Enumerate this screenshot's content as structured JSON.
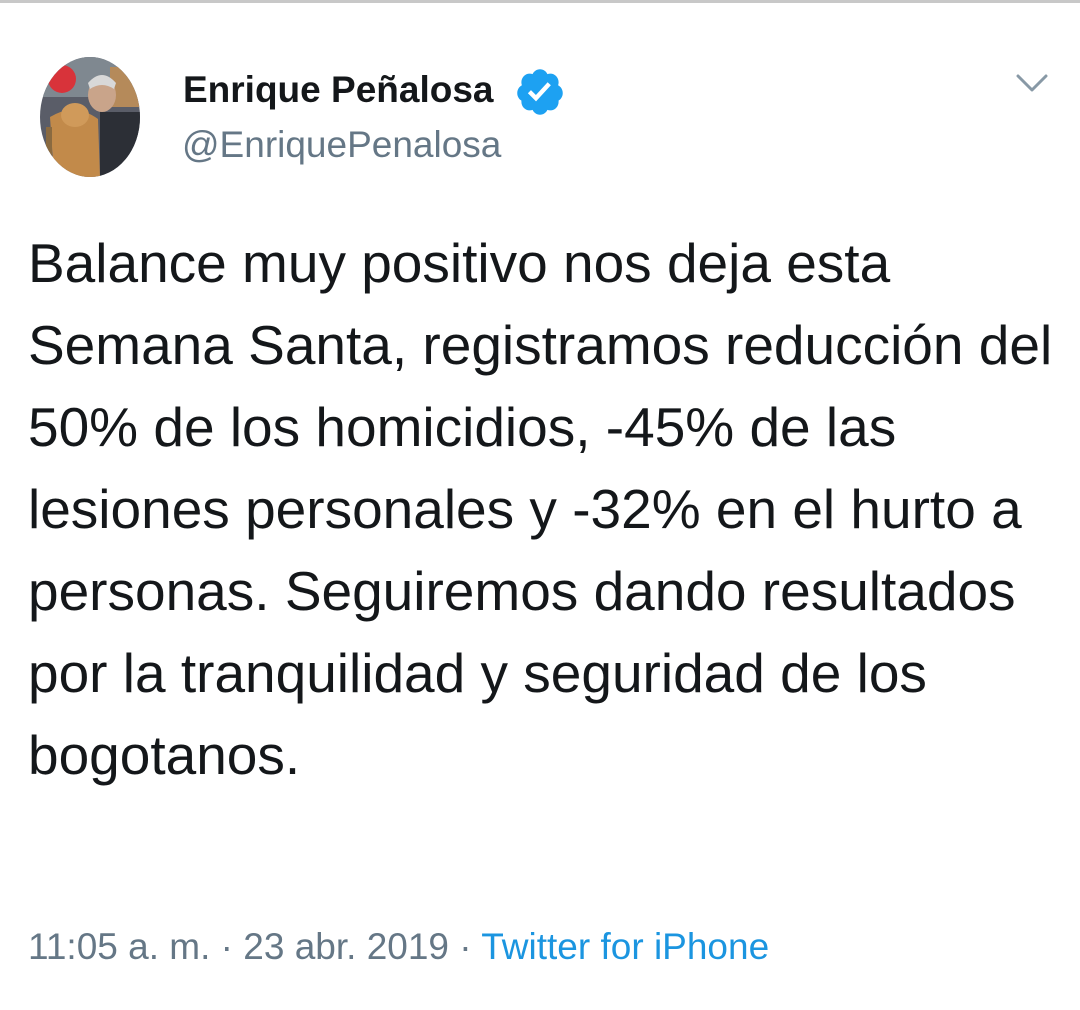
{
  "author": {
    "display_name": "Enrique Peñalosa",
    "handle": "@EnriquePenalosa",
    "verified": true
  },
  "tweet": {
    "text": "Balance muy positivo nos deja esta Semana Santa, registramos reducción del 50% de los homicidios, -45% de las lesiones personales y -32% en el hurto a personas. Seguiremos dando resultados por la tranquilidad y seguridad de los bogotanos."
  },
  "meta": {
    "time": "11:05 a. m.",
    "separator": "·",
    "date": "23 abr. 2019",
    "source": "Twitter for iPhone"
  },
  "icons": {
    "verified": "verified-badge-icon",
    "menu": "chevron-down-icon"
  },
  "colors": {
    "text": "#14171a",
    "secondary": "#657786",
    "link": "#1b95e0",
    "verified": "#1da1f2"
  }
}
